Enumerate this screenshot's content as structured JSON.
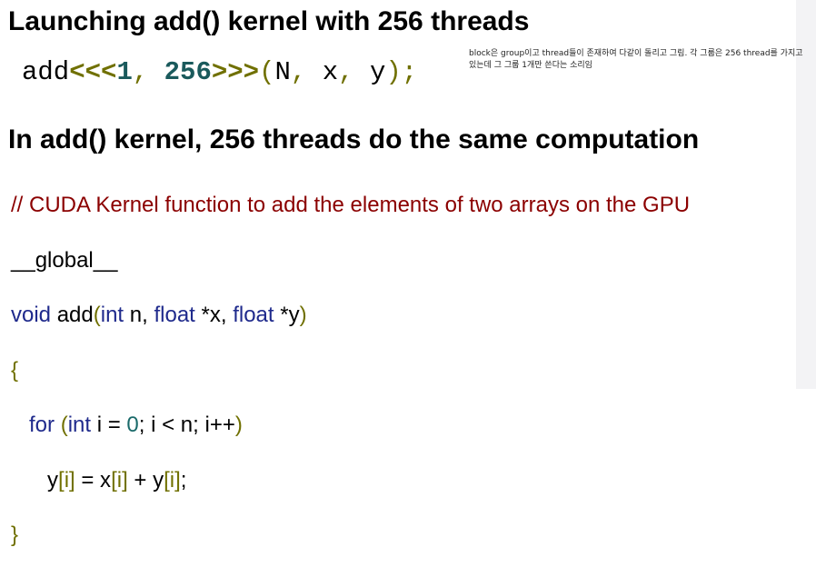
{
  "heading1": "Launching add() kernel with 256 threads",
  "launch": {
    "func": "add",
    "open": "<<<",
    "blocks": "1",
    "comma1": ", ",
    "threads": "256",
    "close": ">>>",
    "args_open": "(",
    "arg1": "N",
    "comma2": ", ",
    "arg2": "x",
    "comma3": ", ",
    "arg3": "y",
    "end": ");"
  },
  "note": "block은 group이고 thread들이 존재하여 다같이 돌리고 그림. 각 그룹은 256 thread를 가지고 있는데 그 그룹 1개만 쓴다는 소리임",
  "heading2": "In add() kernel, 256 threads do the same computation",
  "code": {
    "comment": "// CUDA Kernel function to add the elements of two arrays on the GPU",
    "qualifier": "__global__",
    "sig_void": "void",
    "sig_name": " add",
    "sig_paren_open": "(",
    "sig_int": "int",
    "sig_n": " n, ",
    "sig_float1": "float",
    "sig_x": " *x, ",
    "sig_float2": "float",
    "sig_y": " *y",
    "sig_paren_close": ")",
    "brace_open": "{",
    "for_indent": "   ",
    "for_kw": "for",
    "for_sp": " ",
    "for_paren_open": "(",
    "for_int": "int",
    "for_init": " i = ",
    "for_zero": "0",
    "for_rest": "; i < n; i++",
    "for_paren_close": ")",
    "body_indent": "      ",
    "body_y": "y",
    "body_lb1": "[",
    "body_i1": "i",
    "body_rb1": "]",
    "body_eq": " = x",
    "body_lb2": "[",
    "body_i2": "i",
    "body_rb2": "]",
    "body_plus": " + y",
    "body_lb3": "[",
    "body_i3": "i",
    "body_rb3": "]",
    "body_end": ";",
    "brace_close": "}"
  }
}
